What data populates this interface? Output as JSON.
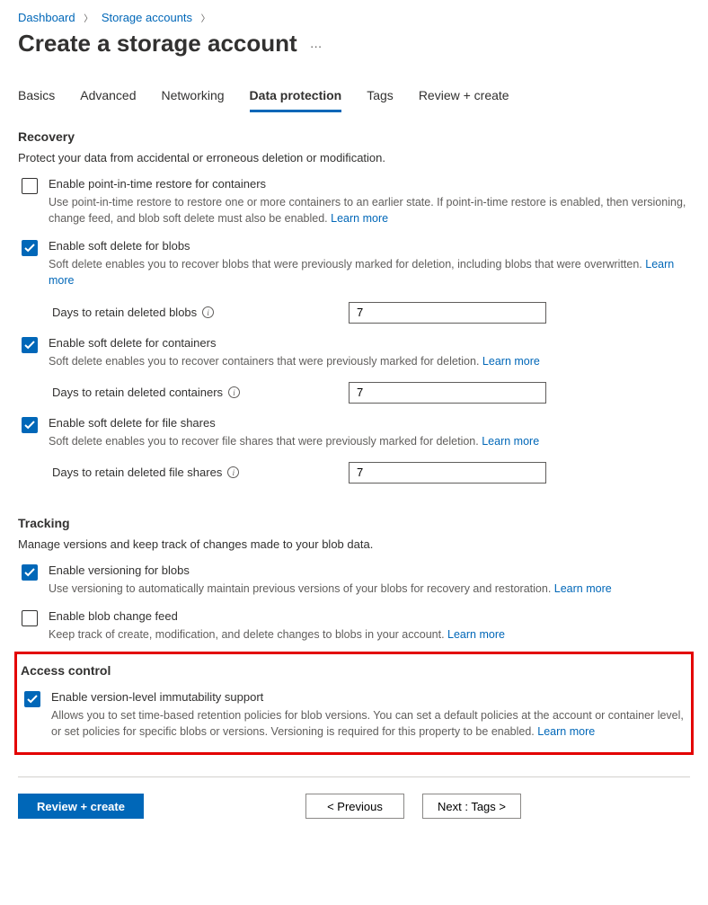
{
  "breadcrumb": {
    "dashboard": "Dashboard",
    "storage": "Storage accounts"
  },
  "page_title": "Create a storage account",
  "tabs": {
    "basics": "Basics",
    "advanced": "Advanced",
    "networking": "Networking",
    "data_protection": "Data protection",
    "tags": "Tags",
    "review": "Review + create"
  },
  "recovery": {
    "title": "Recovery",
    "desc": "Protect your data from accidental or erroneous deletion or modification.",
    "pitr": {
      "label": "Enable point-in-time restore for containers",
      "desc": "Use point-in-time restore to restore one or more containers to an earlier state. If point-in-time restore is enabled, then versioning, change feed, and blob soft delete must also be enabled.",
      "learn": "Learn more"
    },
    "softdel_blobs": {
      "label": "Enable soft delete for blobs",
      "desc": "Soft delete enables you to recover blobs that were previously marked for deletion, including blobs that were overwritten.",
      "learn": "Learn more",
      "field_label": "Days to retain deleted blobs",
      "value": "7"
    },
    "softdel_containers": {
      "label": "Enable soft delete for containers",
      "desc": "Soft delete enables you to recover containers that were previously marked for deletion.",
      "learn": "Learn more",
      "field_label": "Days to retain deleted containers",
      "value": "7"
    },
    "softdel_fileshares": {
      "label": "Enable soft delete for file shares",
      "desc": "Soft delete enables you to recover file shares that were previously marked for deletion.",
      "learn": "Learn more",
      "field_label": "Days to retain deleted file shares",
      "value": "7"
    }
  },
  "tracking": {
    "title": "Tracking",
    "desc": "Manage versions and keep track of changes made to your blob data.",
    "versioning": {
      "label": "Enable versioning for blobs",
      "desc": "Use versioning to automatically maintain previous versions of your blobs for recovery and restoration.",
      "learn": "Learn more"
    },
    "changefeed": {
      "label": "Enable blob change feed",
      "desc": "Keep track of create, modification, and delete changes to blobs in your account.",
      "learn": "Learn more"
    }
  },
  "access_control": {
    "title": "Access control",
    "immutability": {
      "label": "Enable version-level immutability support",
      "desc": "Allows you to set time-based retention policies for blob versions. You can set a default policies at the account or container level, or set policies for specific blobs or versions. Versioning is required for this property to be enabled.",
      "learn": "Learn more"
    }
  },
  "footer": {
    "review": "Review + create",
    "previous": "< Previous",
    "next": "Next : Tags >"
  }
}
